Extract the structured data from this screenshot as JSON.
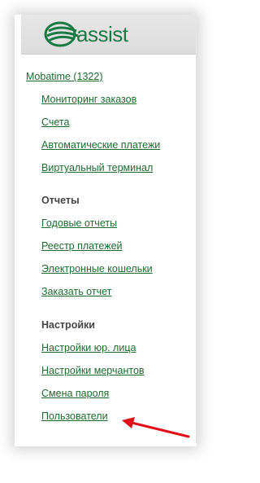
{
  "logo": {
    "text": "assist",
    "brand_color": "#1a7a43"
  },
  "nav": {
    "root_link": "Mobatime (1322)",
    "group1": [
      "Мониторинг заказов",
      "Счета",
      "Автоматические платежи",
      "Виртуальный терминал"
    ],
    "reports_header": "Отчеты",
    "reports": [
      "Годовые отчеты",
      "Реестр платежей",
      "Электронные кошельки",
      "Заказать отчет"
    ],
    "settings_header": "Настройки",
    "settings": [
      "Настройки юр. лица",
      "Настройки мерчантов",
      "Смена пароля",
      "Пользователи"
    ]
  },
  "colors": {
    "link": "#1e6b2f",
    "arrow": "#e0101a"
  }
}
